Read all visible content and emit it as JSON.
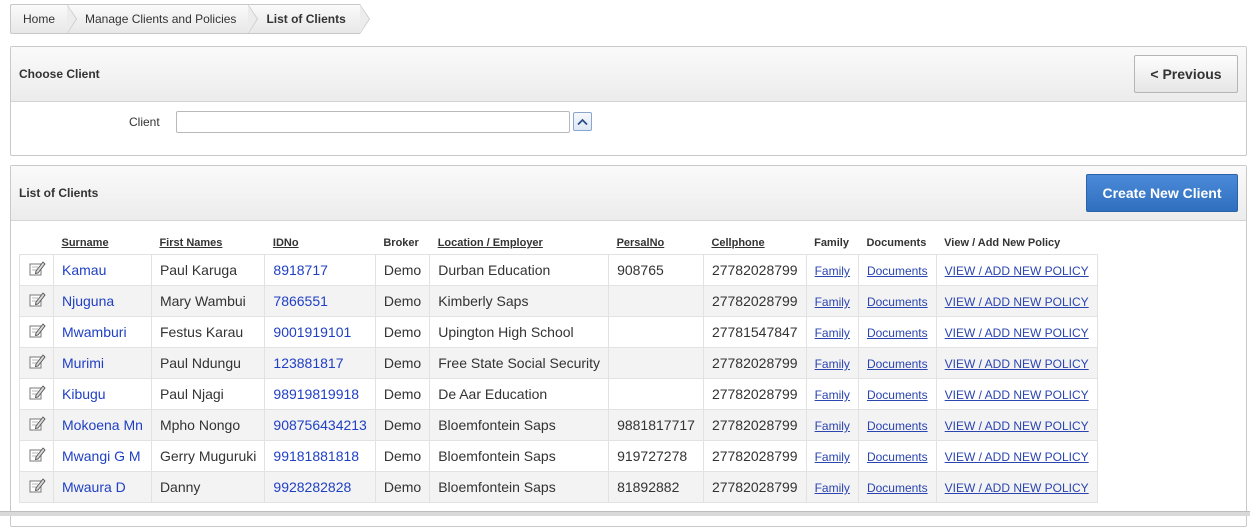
{
  "breadcrumb": [
    "Home",
    "Manage Clients and Policies",
    "List of Clients"
  ],
  "choose_client": {
    "title": "Choose Client",
    "previous_label": "< Previous",
    "client_label": "Client",
    "client_value": ""
  },
  "list": {
    "title": "List of Clients",
    "create_label": "Create New Client",
    "columns": [
      "Surname",
      "First Names",
      "IDNo",
      "Broker",
      "Location / Employer",
      "PersalNo",
      "Cellphone",
      "Family",
      "Documents",
      "View / Add New Policy"
    ],
    "rows": [
      {
        "surname": "Kamau",
        "first": "Paul Karuga",
        "idno": "8918717",
        "broker": "Demo",
        "location": "Durban Education",
        "persal": "908765",
        "cell": "27782028799",
        "family": "Family",
        "docs": "Documents",
        "policy": "VIEW / ADD NEW POLICY"
      },
      {
        "surname": "Njuguna",
        "first": "Mary Wambui",
        "idno": "7866551",
        "broker": "Demo",
        "location": "Kimberly Saps",
        "persal": "",
        "cell": "27782028799",
        "family": "Family",
        "docs": "Documents",
        "policy": "VIEW / ADD NEW POLICY"
      },
      {
        "surname": "Mwamburi",
        "first": "Festus Karau",
        "idno": "9001919101",
        "broker": "Demo",
        "location": "Upington High School",
        "persal": "",
        "cell": "27781547847",
        "family": "Family",
        "docs": "Documents",
        "policy": "VIEW / ADD NEW POLICY"
      },
      {
        "surname": "Murimi",
        "first": "Paul Ndungu",
        "idno": "123881817",
        "broker": "Demo",
        "location": "Free State Social Security",
        "persal": "",
        "cell": "27782028799",
        "family": "Family",
        "docs": "Documents",
        "policy": "VIEW / ADD NEW POLICY"
      },
      {
        "surname": "Kibugu",
        "first": "Paul Njagi",
        "idno": "98919819918",
        "broker": "Demo",
        "location": "De Aar Education",
        "persal": "",
        "cell": "27782028799",
        "family": "Family",
        "docs": "Documents",
        "policy": "VIEW / ADD NEW POLICY"
      },
      {
        "surname": "Mokoena Mn",
        "first": "Mpho Nongo",
        "idno": "908756434213",
        "broker": "Demo",
        "location": "Bloemfontein Saps",
        "persal": "9881817717",
        "cell": "27782028799",
        "family": "Family",
        "docs": "Documents",
        "policy": "VIEW / ADD NEW POLICY"
      },
      {
        "surname": "Mwangi G M",
        "first": "Gerry Muguruki",
        "idno": "99181881818",
        "broker": "Demo",
        "location": "Bloemfontein Saps",
        "persal": "919727278",
        "cell": "27782028799",
        "family": "Family",
        "docs": "Documents",
        "policy": "VIEW / ADD NEW POLICY"
      },
      {
        "surname": "Mwaura D",
        "first": "Danny",
        "idno": "9928282828",
        "broker": "Demo",
        "location": "Bloemfontein Saps",
        "persal": "81892882",
        "cell": "27782028799",
        "family": "Family",
        "docs": "Documents",
        "policy": "VIEW / ADD NEW POLICY"
      }
    ]
  }
}
